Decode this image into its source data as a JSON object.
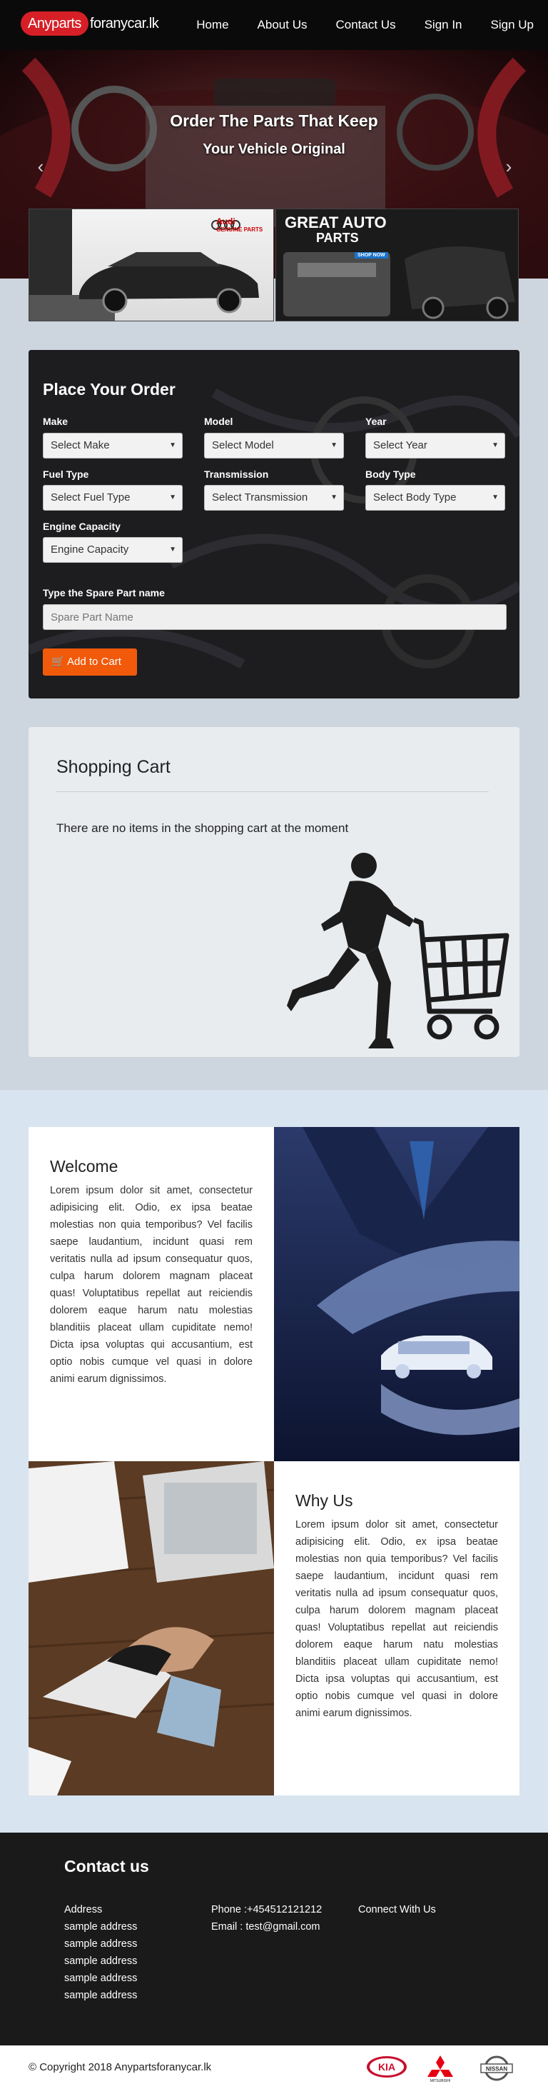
{
  "nav": {
    "brand_highlight": "Anyparts",
    "brand_rest": "foranycar.lk",
    "links": [
      "Home",
      "About Us",
      "Contact Us",
      "Sign In",
      "Sign Up"
    ]
  },
  "hero": {
    "title": "Order The Parts That Keep",
    "subtitle": "Your Vehicle Original",
    "prev_icon": "chevron-left-icon",
    "next_icon": "chevron-right-icon",
    "ad_left": {
      "brand": "Audi",
      "tag": "GENUINE PARTS"
    },
    "ad_right": {
      "line1": "GREAT AUTO",
      "line2": "PARTS",
      "cta": "SHOP NOW"
    }
  },
  "order": {
    "title": "Place Your Order",
    "fields": [
      {
        "label": "Make",
        "value": "Select Make"
      },
      {
        "label": "Model",
        "value": "Select Model"
      },
      {
        "label": "Year",
        "value": "Select Year"
      },
      {
        "label": "Fuel Type",
        "value": "Select Fuel Type"
      },
      {
        "label": "Transmission",
        "value": "Select Transmission"
      },
      {
        "label": "Body Type",
        "value": "Select Body Type"
      },
      {
        "label": "Engine Capacity",
        "value": "Engine Capacity"
      }
    ],
    "part_label": "Type the Spare Part name",
    "part_placeholder": "Spare Part Name",
    "add_button": "Add to Cart",
    "add_icon": "cart-icon"
  },
  "cart": {
    "title": "Shopping Cart",
    "empty_message": "There are no items in the shopping cart at the moment"
  },
  "welcome": {
    "title": "Welcome",
    "body": "Lorem ipsum dolor sit amet, consectetur adipisicing elit. Odio, ex ipsa beatae molestias non quia temporibus? Vel facilis saepe laudantium, incidunt quasi rem veritatis nulla ad ipsum consequatur quos, culpa harum dolorem magnam placeat quas! Voluptatibus repellat aut reiciendis dolorem eaque harum natu molestias blanditiis placeat ullam cupiditate nemo! Dicta ipsa voluptas qui accusantium, est optio nobis cumque vel quasi in dolore animi earum dignissimos."
  },
  "why_us": {
    "title": "Why Us",
    "body": "Lorem ipsum dolor sit amet, consectetur adipisicing elit. Odio, ex ipsa beatae molestias non quia temporibus? Vel facilis saepe laudantium, incidunt quasi rem veritatis nulla ad ipsum consequatur quos, culpa harum dolorem magnam placeat quas! Voluptatibus repellat aut reiciendis dolorem eaque harum natu molestias blanditiis placeat ullam cupiditate nemo! Dicta ipsa voluptas qui accusantium, est optio nobis cumque vel quasi in dolore animi earum dignissimos."
  },
  "footer": {
    "title": "Contact us",
    "address_heading": "Address",
    "address_lines": [
      "sample address",
      "sample address",
      "sample address",
      "sample address",
      "sample address"
    ],
    "phone": "Phone :+454512121212",
    "email": "Email : test@gmail.com",
    "connect": "Connect With Us",
    "copyright": "© Copyright 2018 Anypartsforanycar.lk",
    "brand_logos": [
      "KIA",
      "MITSUBISHI",
      "NISSAN"
    ]
  },
  "colors": {
    "accent": "#f15a0a",
    "brand_red": "#d61f26",
    "nav_bg": "#0a0a0a",
    "footer_bg": "#1a1a1a"
  }
}
